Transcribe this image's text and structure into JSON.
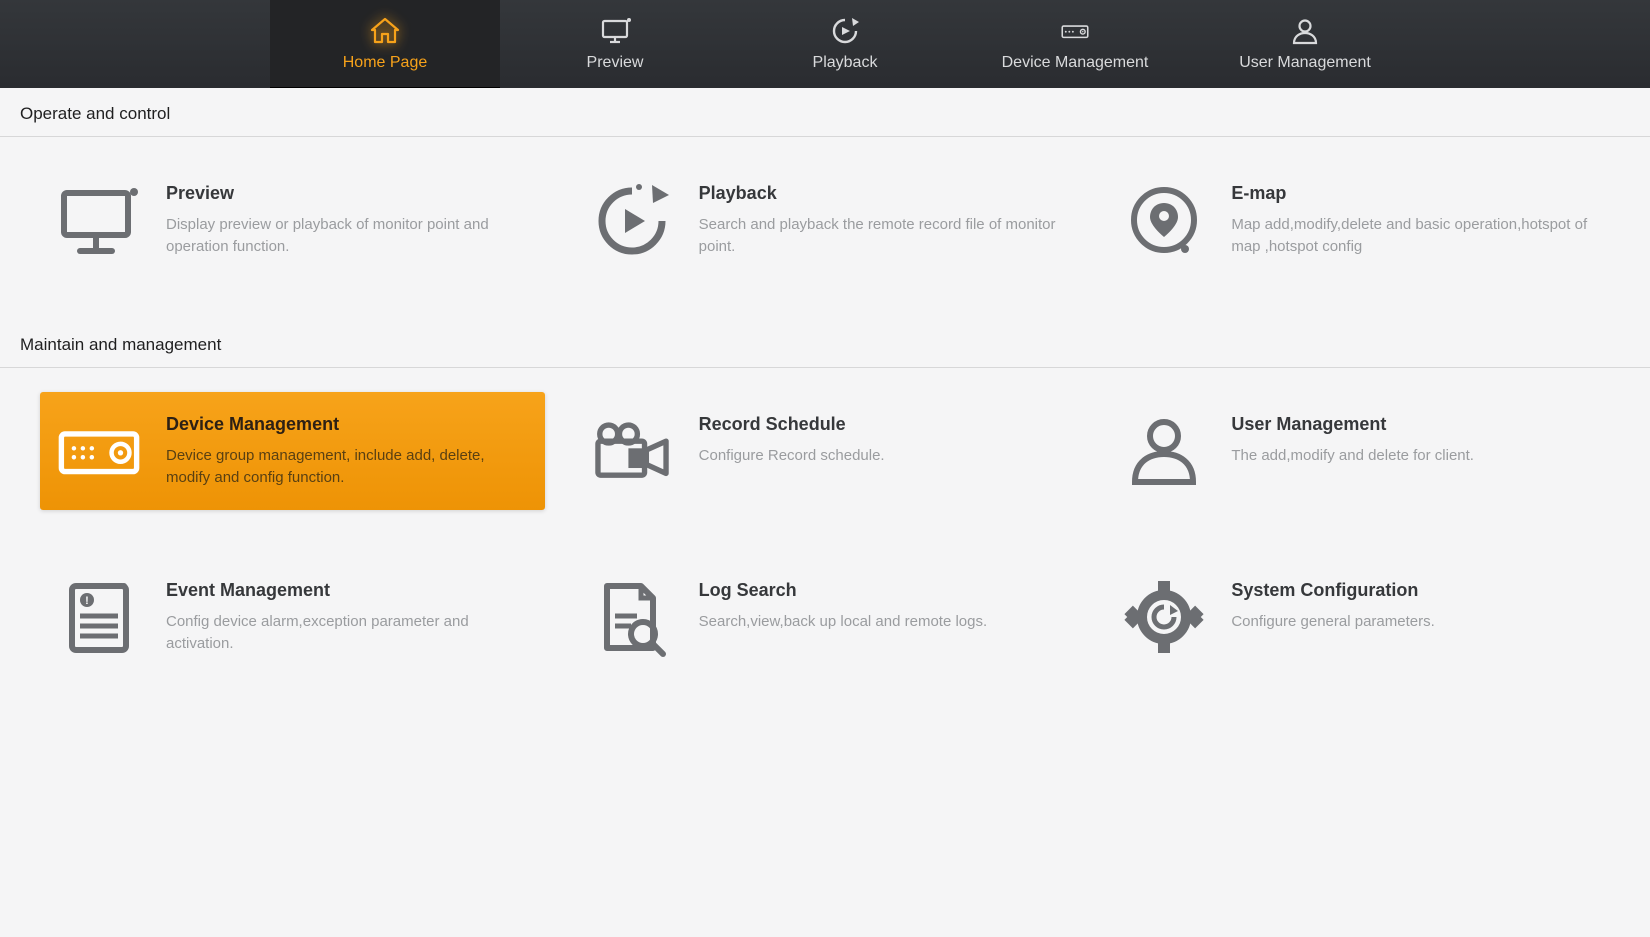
{
  "nav": {
    "tabs": [
      {
        "label": "Home Page"
      },
      {
        "label": "Preview"
      },
      {
        "label": "Playback"
      },
      {
        "label": "Device Management"
      },
      {
        "label": "User Management"
      }
    ]
  },
  "sections": {
    "operate": {
      "header": "Operate and control",
      "cards": [
        {
          "title": "Preview",
          "desc": "Display preview or playback of monitor point and operation function."
        },
        {
          "title": "Playback",
          "desc": "Search and playback the remote record file of monitor point."
        },
        {
          "title": "E-map",
          "desc": "Map add,modify,delete and basic operation,hotspot of map ,hotspot config"
        }
      ]
    },
    "maintain": {
      "header": "Maintain and management",
      "cards": [
        {
          "title": "Device Management",
          "desc": "Device group management, include add, delete, modify and config function."
        },
        {
          "title": "Record Schedule",
          "desc": "Configure Record schedule."
        },
        {
          "title": "User Management",
          "desc": "The add,modify and delete for client."
        },
        {
          "title": "Event Management",
          "desc": "Config device alarm,exception parameter and activation."
        },
        {
          "title": "Log Search",
          "desc": "Search,view,back up local and remote logs."
        },
        {
          "title": "System Configuration",
          "desc": "Configure general parameters."
        }
      ]
    }
  }
}
